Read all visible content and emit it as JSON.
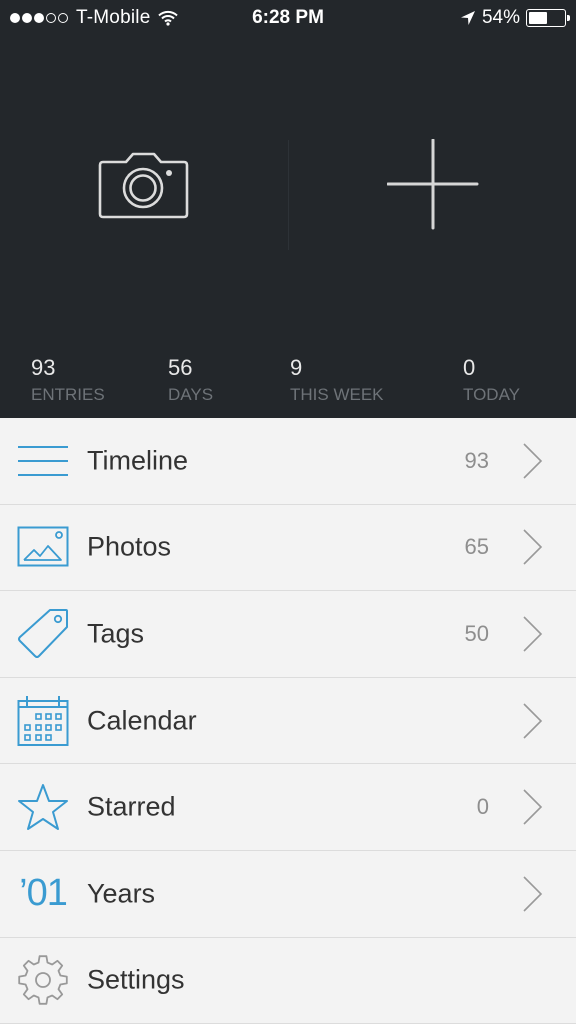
{
  "status_bar": {
    "signal_dots_filled": 3,
    "signal_dots_total": 5,
    "carrier": "T-Mobile",
    "time": "6:28 PM",
    "battery_percent_label": "54%",
    "battery_level": 0.54,
    "icons": [
      "signal-icon",
      "wifi-icon",
      "location-arrow-icon",
      "battery-icon"
    ]
  },
  "header": {
    "actions": [
      {
        "name": "camera",
        "icon": "camera-icon"
      },
      {
        "name": "add-entry",
        "icon": "plus-icon"
      }
    ],
    "stats": [
      {
        "value": "93",
        "label": "ENTRIES"
      },
      {
        "value": "56",
        "label": "DAYS"
      },
      {
        "value": "9",
        "label": "THIS WEEK"
      },
      {
        "value": "0",
        "label": "TODAY"
      }
    ]
  },
  "menu": {
    "items": [
      {
        "label": "Timeline",
        "count": "93",
        "icon": "timeline-icon",
        "chevron": true
      },
      {
        "label": "Photos",
        "count": "65",
        "icon": "photos-icon",
        "chevron": true
      },
      {
        "label": "Tags",
        "count": "50",
        "icon": "tag-icon",
        "chevron": true
      },
      {
        "label": "Calendar",
        "count": "",
        "icon": "calendar-icon",
        "chevron": true
      },
      {
        "label": "Starred",
        "count": "0",
        "icon": "star-icon",
        "chevron": true
      },
      {
        "label": "Years",
        "count": "",
        "icon": "years-icon",
        "icon_text": "’01",
        "chevron": true
      },
      {
        "label": "Settings",
        "count": "",
        "icon": "gear-icon",
        "chevron": false
      }
    ]
  },
  "colors": {
    "header_bg": "#23272b",
    "accent": "#3a9bd1",
    "list_bg": "#f3f3f3",
    "divider": "#dcdcdc",
    "count_text": "#8e8e8e",
    "stat_label": "#6e7378"
  }
}
